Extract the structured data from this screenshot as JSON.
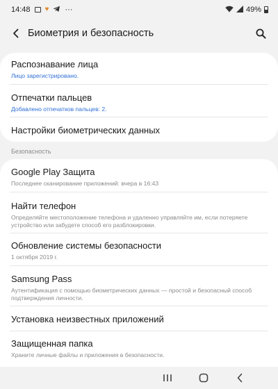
{
  "statusbar": {
    "time": "14:48",
    "dots": "···",
    "battery": "49%"
  },
  "header": {
    "title": "Биометрия и безопасность"
  },
  "biometrics": [
    {
      "label": "Распознавание лица",
      "sub": "Лицо зарегистрировано."
    },
    {
      "label": "Отпечатки пальцев",
      "sub": "Добавлено отпечатков пальцев: 2."
    },
    {
      "label": "Настройки биометрических данных"
    }
  ],
  "security": {
    "header": "Безопасность",
    "items": [
      {
        "label": "Google Play Защита",
        "sub": "Последнее сканирование приложений: вчера в 16:43"
      },
      {
        "label": "Найти телефон",
        "sub": "Определяйте местоположение телефона и удаленно управляйте им, если потеряете устройство или забудете способ его разблокировки."
      },
      {
        "label": "Обновление системы безопасности",
        "sub": "1 октября 2019 г."
      },
      {
        "label": "Samsung Pass",
        "sub": "Аутентификация с помощью биометрических данных — простой и безопасный способ подтверждения личности."
      },
      {
        "label": "Установка неизвестных приложений"
      },
      {
        "label": "Защищенная папка",
        "sub": "Храните личные файлы и приложения в безопасности."
      }
    ]
  },
  "colors": {
    "accent": "#2f6fd6",
    "background": "#f2f2f2",
    "card": "#ffffff",
    "secondary_text": "#8a8a8a"
  }
}
